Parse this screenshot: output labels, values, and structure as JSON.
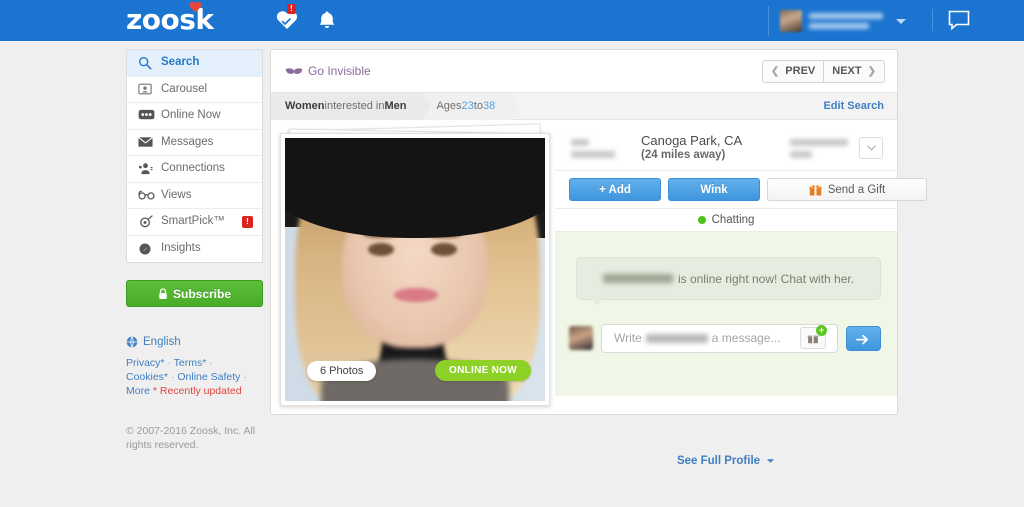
{
  "topnav": {
    "brand": "zoosk",
    "heart_badge": "!",
    "icons": {
      "heart": "heart-icon",
      "bell": "bell-icon",
      "chat": "chat-bubble-icon"
    },
    "user": {
      "name_redacted": "",
      "location_redacted": ""
    },
    "bg_color": "#1b75d0"
  },
  "sidebar": {
    "items": [
      {
        "label": "Search",
        "icon": "search-icon",
        "active": true,
        "alert": ""
      },
      {
        "label": "Carousel",
        "icon": "carousel-icon",
        "active": false,
        "alert": ""
      },
      {
        "label": "Online Now",
        "icon": "online-now-icon",
        "active": false,
        "alert": ""
      },
      {
        "label": "Messages",
        "icon": "envelope-icon",
        "active": false,
        "alert": ""
      },
      {
        "label": "Connections",
        "icon": "connections-icon",
        "active": false,
        "alert": ""
      },
      {
        "label": "Views",
        "icon": "glasses-icon",
        "active": false,
        "alert": ""
      },
      {
        "label": "SmartPick™",
        "icon": "smartpick-icon",
        "active": false,
        "alert": "!"
      },
      {
        "label": "Insights",
        "icon": "insights-icon",
        "active": false,
        "alert": ""
      }
    ],
    "subscribe_label": "Subscribe",
    "subscribe_color": "#4fae2a",
    "language": "English",
    "footer": {
      "privacy": "Privacy*",
      "terms": "Terms*",
      "cookies": "Cookies*",
      "online_safety": "Online Safety",
      "more": "More",
      "recently_updated": "* Recently updated"
    },
    "copyright": "© 2007-2016 Zoosk, Inc. All rights reserved."
  },
  "main": {
    "go_invisible": "Go Invisible",
    "prev_label": "PREV",
    "next_label": "NEXT",
    "filters": {
      "gender_pre": "Women",
      "gender_mid": " interested in ",
      "gender_post": "Men",
      "ages_pre": "Ages ",
      "age_min": "23",
      "ages_mid": " to ",
      "age_max": "38",
      "edit_search": "Edit Search"
    },
    "photo": {
      "photos_badge": "6 Photos",
      "online_badge": "ONLINE NOW",
      "alt": "blurred-profile-photo"
    },
    "profile": {
      "age_redacted": "",
      "location": "Canoga Park, CA",
      "distance": "(24 miles away)",
      "username_redacted": ""
    },
    "buttons": {
      "add": "+ Add",
      "wink": "Wink",
      "send_gift": "Send a Gift"
    },
    "status": {
      "label": "Chatting",
      "color": "#4fc21a"
    },
    "chat": {
      "notice_suffix": "is online right now! Chat with her.",
      "composer_placeholder_pre": "Write",
      "composer_placeholder_post": "a message...",
      "gift_badge": "+"
    },
    "see_full_profile": "See Full Profile"
  }
}
